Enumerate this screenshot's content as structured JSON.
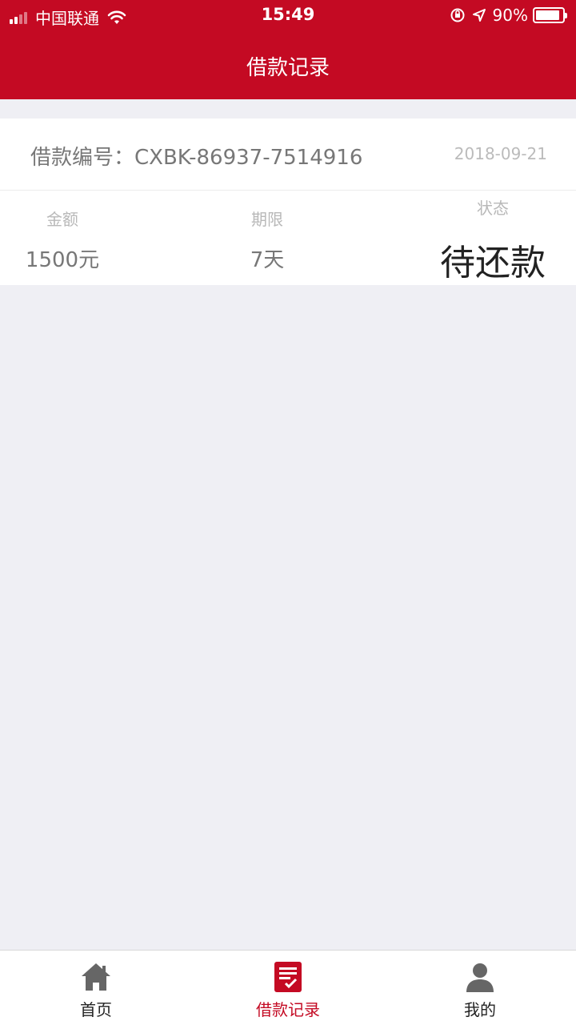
{
  "status_bar": {
    "carrier": "中国联通",
    "time": "15:49",
    "battery": "90%"
  },
  "header": {
    "title": "借款记录"
  },
  "record": {
    "loan_no": "借款编号：CXBK-86937-7514916",
    "date": "2018-09-21",
    "amount_label": "金额",
    "amount_value": "1500元",
    "term_label": "期限",
    "term_value": "7天",
    "status_label": "状态",
    "status_value": "待还款"
  },
  "tabbar": {
    "items": [
      {
        "label": "首页",
        "icon": "home-icon"
      },
      {
        "label": "借款记录",
        "icon": "records-icon"
      },
      {
        "label": "我的",
        "icon": "user-icon"
      }
    ],
    "active_index": 1,
    "active_color": "#c40a23",
    "inactive_color": "#666666"
  },
  "colors": {
    "brand": "#c40a23",
    "background": "#efeff4"
  }
}
